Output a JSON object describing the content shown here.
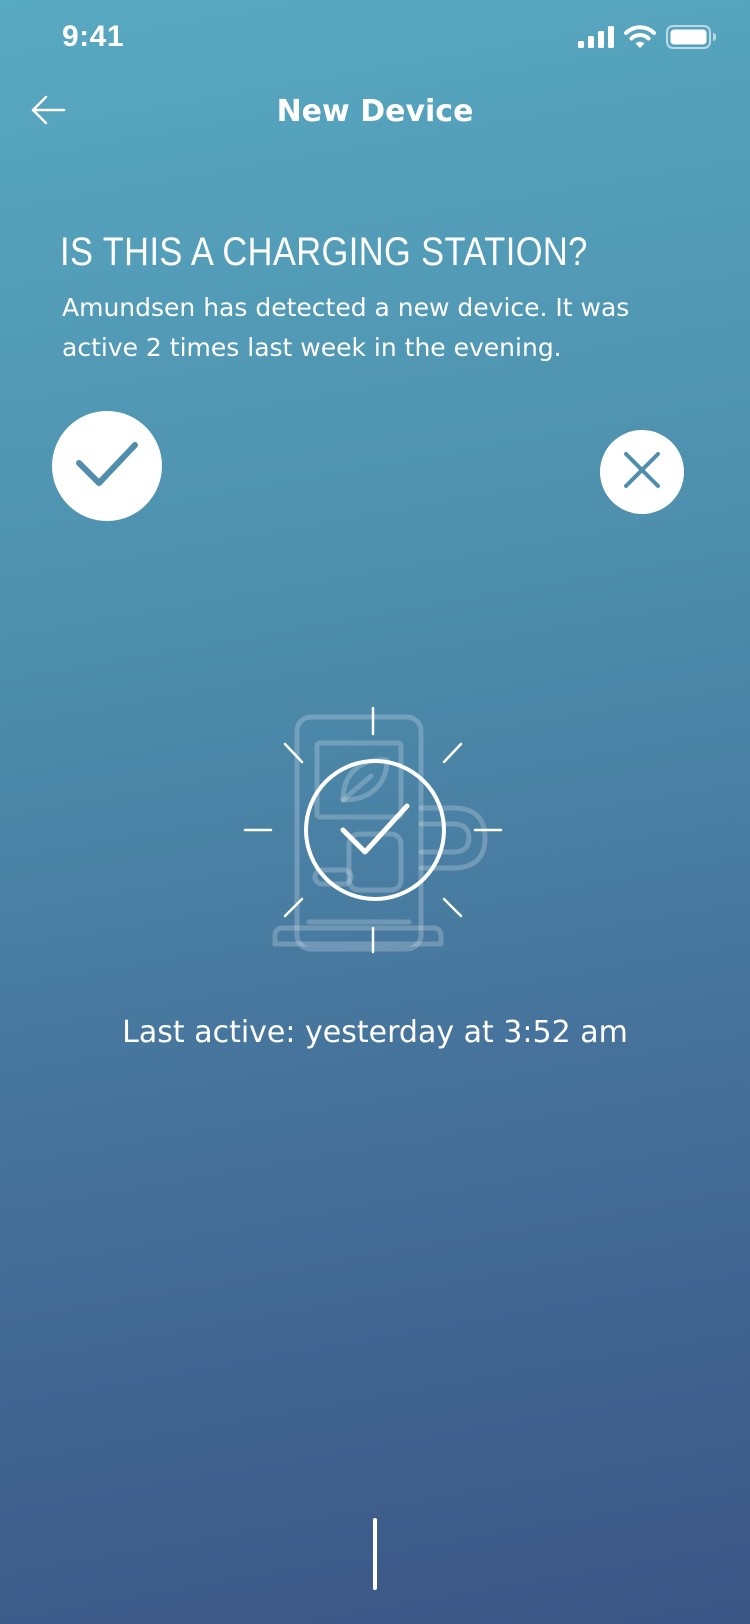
{
  "status_bar": {
    "time": "9:41",
    "icons": [
      "signal-icon",
      "wifi-icon",
      "battery-icon"
    ]
  },
  "nav": {
    "back_icon": "arrow-left-icon",
    "title": "New Device"
  },
  "question": {
    "title": "IS THIS A CHARGING STATION?",
    "description": "Amundsen has detected a new device. It was active 2 times last week in the evening."
  },
  "actions": {
    "confirm_icon": "checkmark-icon",
    "reject_icon": "close-icon"
  },
  "illustration": {
    "icon": "charging-station-icon"
  },
  "device": {
    "last_active": "Last active: yesterday at 3:52 am"
  },
  "colors": {
    "background_top": "#58a9c2",
    "background_bottom": "#3b5585",
    "accent": "#4f8eac",
    "text": "#ffffff"
  }
}
